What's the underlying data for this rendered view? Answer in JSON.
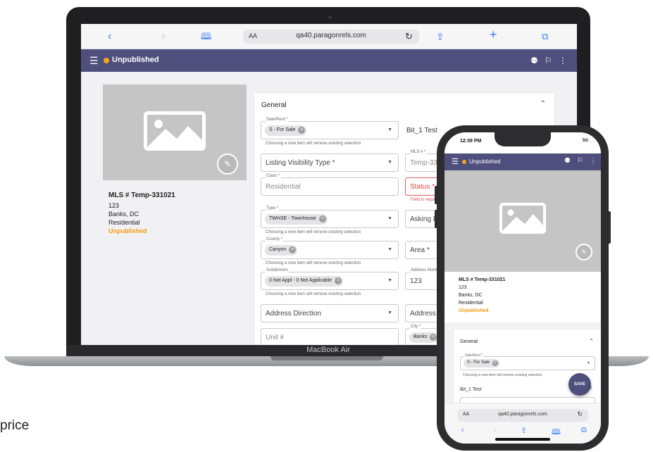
{
  "browser": {
    "url": "qa40.paragonrels.com",
    "text_size": "AA",
    "icons": [
      "chevron-left-icon",
      "chevron-right-icon",
      "book-icon",
      "reload-icon",
      "share-icon",
      "plus-icon",
      "tabs-icon"
    ]
  },
  "app": {
    "title": "Unpublished",
    "status_color": "#f5a31a",
    "bar_color": "#4f4f7d"
  },
  "listing": {
    "mls": "MLS # Temp-331021",
    "street_number": "123",
    "city_state": "Banks, DC",
    "class": "Residential",
    "status": "Unpublished"
  },
  "form": {
    "section_title": "General",
    "hint_replace": "Choosing a new item will remove existing selection",
    "sale_rent": {
      "label": "Sale/Rent *",
      "value": "S - For Sale"
    },
    "bit_test": "Bit_1 Test",
    "listing_visibility": {
      "placeholder": "Listing Visibility Type *"
    },
    "mls_number": {
      "label": "MLS # *",
      "value": "Temp-331021"
    },
    "class": {
      "label": "Class *",
      "value": "Residential"
    },
    "status": {
      "placeholder": "Status *",
      "error": "Field is required"
    },
    "type": {
      "label": "Type *",
      "value": "TWHSE - Townhouse"
    },
    "asking_price": {
      "placeholder": "Asking Price*"
    },
    "county": {
      "label": "County *",
      "value": "Canyon"
    },
    "area": {
      "placeholder": "Area *"
    },
    "subdivision": {
      "label": "Subdivision",
      "value": "0 Not Appl - 0 Not Applicable"
    },
    "address_number": {
      "label": "Address Number*",
      "value": "123"
    },
    "address_direction": {
      "placeholder": "Address Direction"
    },
    "address_street": {
      "placeholder": "Address Stree"
    },
    "unit": {
      "placeholder": "Unit #"
    },
    "city": {
      "label": "City *",
      "value": "Banks"
    }
  },
  "laptop": {
    "label": "MacBook Air"
  },
  "phone": {
    "time": "12:39 PM",
    "signal": "5G",
    "save_label": "SAVE",
    "fragment": "0",
    "url": "qa40.paragonrels.com",
    "text_size": "AA"
  },
  "caption": "price"
}
